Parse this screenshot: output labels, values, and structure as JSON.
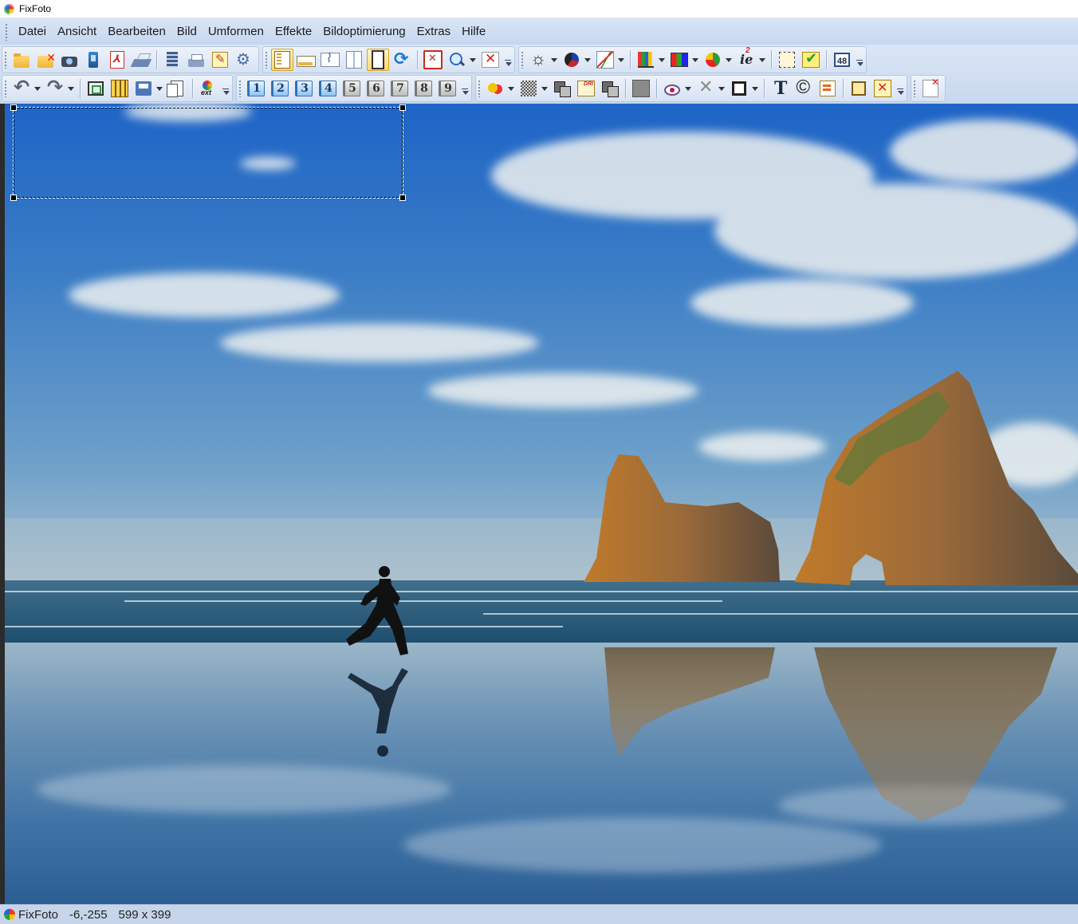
{
  "window": {
    "title": "FixFoto"
  },
  "menu": [
    "Datei",
    "Ansicht",
    "Bearbeiten",
    "Bild",
    "Umformen",
    "Effekte",
    "Bildoptimierung",
    "Extras",
    "Hilfe"
  ],
  "toolbar": {
    "numbers": [
      "1",
      "2",
      "3",
      "4",
      "5",
      "6",
      "7",
      "8",
      "9"
    ],
    "size_badge": "48"
  },
  "status": {
    "app": "FixFoto",
    "coords": "-6,-255",
    "dimensions": "599 x 399"
  },
  "colors": {
    "menubar": "#c6d7ef",
    "statusbar": "#c6d5ea",
    "highlight": "#ffd76e"
  }
}
